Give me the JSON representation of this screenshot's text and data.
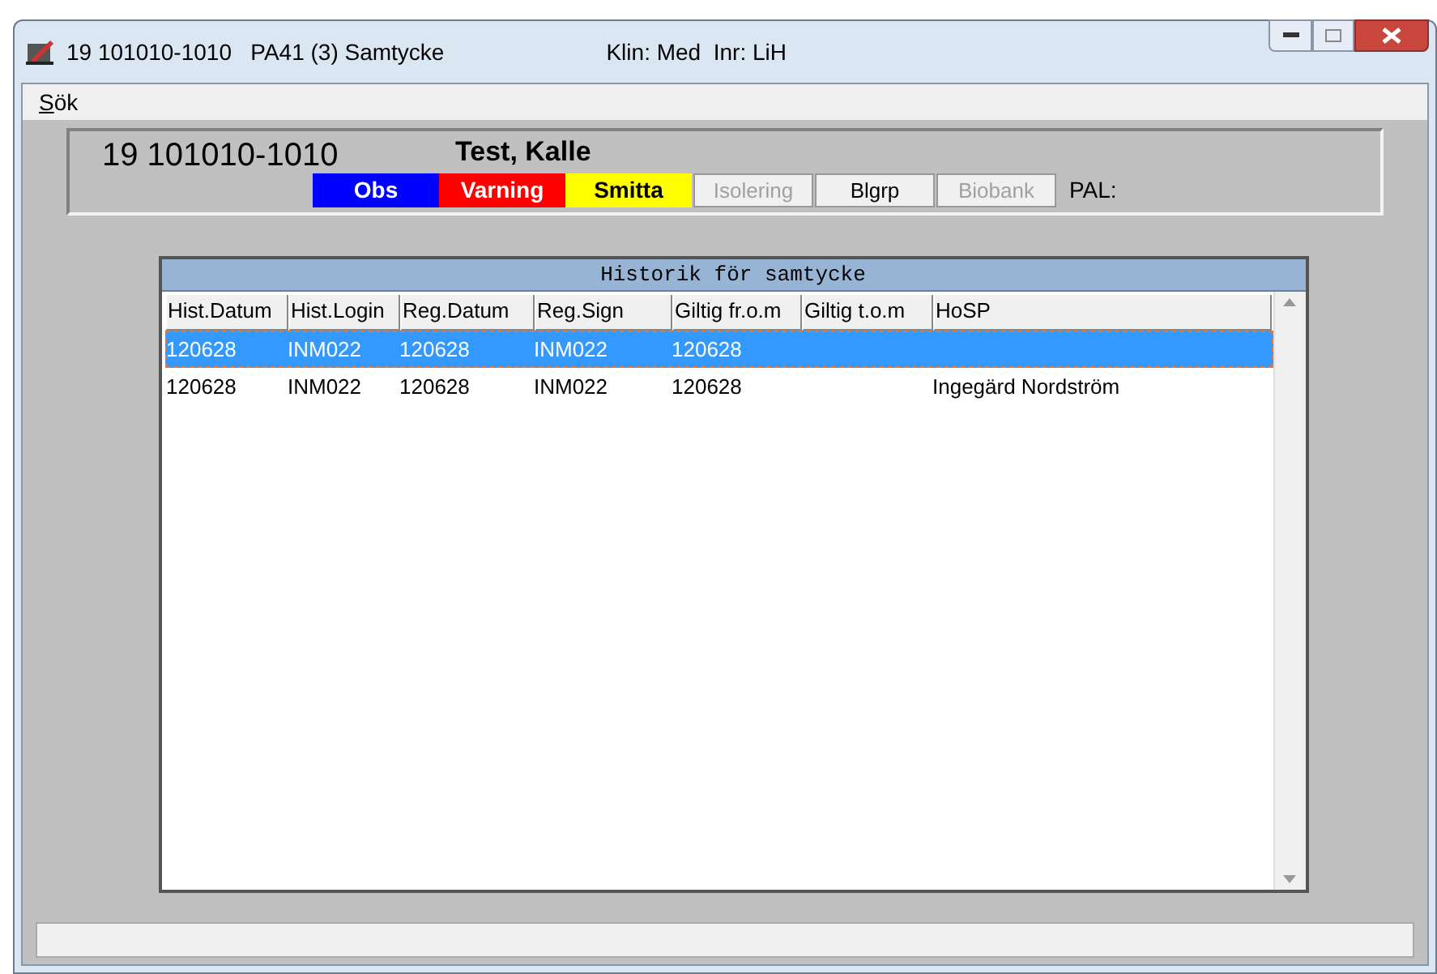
{
  "window": {
    "title": "19 101010-1010   PA41 (3) Samtycke",
    "info": "Klin: Med  Inr: LiH"
  },
  "menu": [
    {
      "label": "Sök"
    }
  ],
  "patient": {
    "id": "19 101010-1010",
    "name": "Test, Kalle",
    "pal_label": "PAL:",
    "flags": [
      {
        "kind": "flag",
        "label": "Obs",
        "color": "#0000ff"
      },
      {
        "kind": "flag",
        "label": "Varning",
        "color": "#ff0000"
      },
      {
        "kind": "flag",
        "label": "Smitta",
        "color": "#ffff00"
      },
      {
        "kind": "button",
        "label": "Isolering",
        "disabled": true
      },
      {
        "kind": "button",
        "label": "Blgrp",
        "disabled": false
      },
      {
        "kind": "button",
        "label": "Biobank",
        "disabled": true
      }
    ]
  },
  "table": {
    "title": "Historik för samtycke",
    "columns": [
      "Hist.Datum",
      "Hist.Login",
      "Reg.Datum",
      "Reg.Sign",
      "Giltig fr.o.m",
      "Giltig t.o.m",
      "HoSP"
    ],
    "rows": [
      {
        "selected": true,
        "cells": [
          "120628",
          "INM022",
          "120628",
          "INM022",
          "120628",
          "",
          ""
        ]
      },
      {
        "selected": false,
        "cells": [
          "120628",
          "INM022",
          "120628",
          "INM022",
          "120628",
          "",
          "Ingegärd Nordström"
        ]
      }
    ]
  }
}
